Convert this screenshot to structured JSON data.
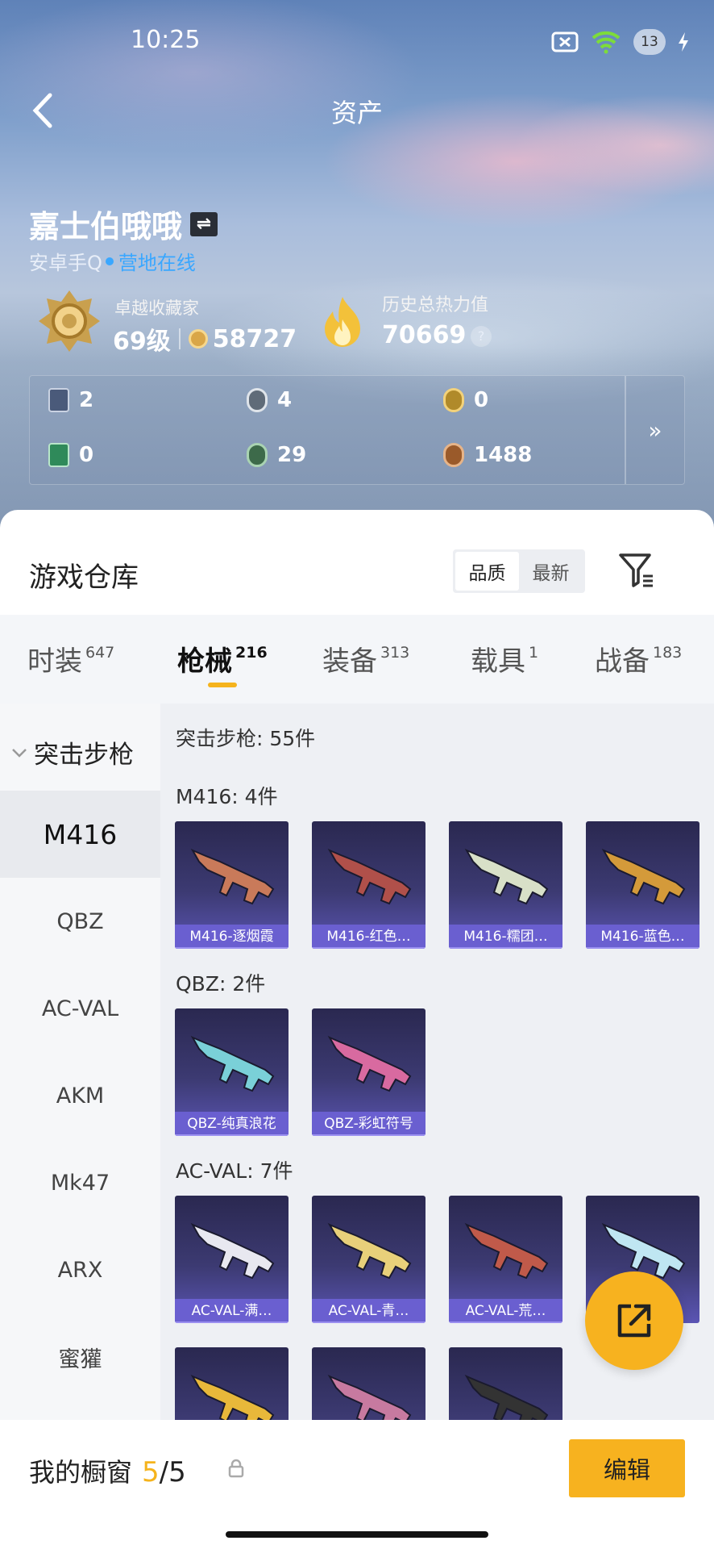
{
  "status_bar": {
    "time": "10:25",
    "battery": "13"
  },
  "header": {
    "title": "资产"
  },
  "profile": {
    "name": "嘉士伯哦哦",
    "platform": "安卓手Q",
    "online_status": "营地在线",
    "rank_label": "卓越收藏家",
    "level": "69级",
    "points": "58727",
    "heat_label": "历史总热力值",
    "heat_value": "70669",
    "help": "?"
  },
  "stats": [
    {
      "icon": "card-icon",
      "value": "2",
      "color": "#4a5a7a"
    },
    {
      "icon": "silver-coin-icon",
      "value": "4",
      "color": "#5f6b78"
    },
    {
      "icon": "gold-coin-icon",
      "value": "0",
      "color": "#b08a2a"
    },
    {
      "icon": "green-card-icon",
      "value": "0",
      "color": "#2f8a5a"
    },
    {
      "icon": "green-orb-icon",
      "value": "29",
      "color": "#3d6a4a"
    },
    {
      "icon": "bronze-coin-icon",
      "value": "1488",
      "color": "#9a5a2a"
    }
  ],
  "stats_more": "»",
  "warehouse": {
    "title": "游戏仓库",
    "sort_options": [
      "品质",
      "最新"
    ],
    "selected_sort": "品质"
  },
  "tabs": [
    {
      "label": "时装",
      "count": "647"
    },
    {
      "label": "枪械",
      "count": "216"
    },
    {
      "label": "装备",
      "count": "313"
    },
    {
      "label": "载具",
      "count": "1"
    },
    {
      "label": "战备",
      "count": "183"
    }
  ],
  "sidebar": {
    "group": "突击步枪",
    "items": [
      "M416",
      "QBZ",
      "AC-VAL",
      "AKM",
      "Mk47",
      "ARX",
      "蜜獾"
    ]
  },
  "content": {
    "summary": "突击步枪: 55件",
    "sections": [
      {
        "title": "M416: 4件",
        "items": [
          "M416-逐烟霞",
          "M416-红色…",
          "M416-糯团…",
          "M416-蓝色…"
        ]
      },
      {
        "title": "QBZ: 2件",
        "items": [
          "QBZ-纯真浪花",
          "QBZ-彩虹符号"
        ]
      },
      {
        "title": "AC-VAL: 7件",
        "items": [
          "AC-VAL-满…",
          "AC-VAL-青…",
          "AC-VAL-荒…"
        ]
      }
    ]
  },
  "showcase": {
    "title": "我的橱窗",
    "current": "5",
    "total": "/5",
    "edit_label": "编辑"
  },
  "accent_color": "#f7b21f"
}
